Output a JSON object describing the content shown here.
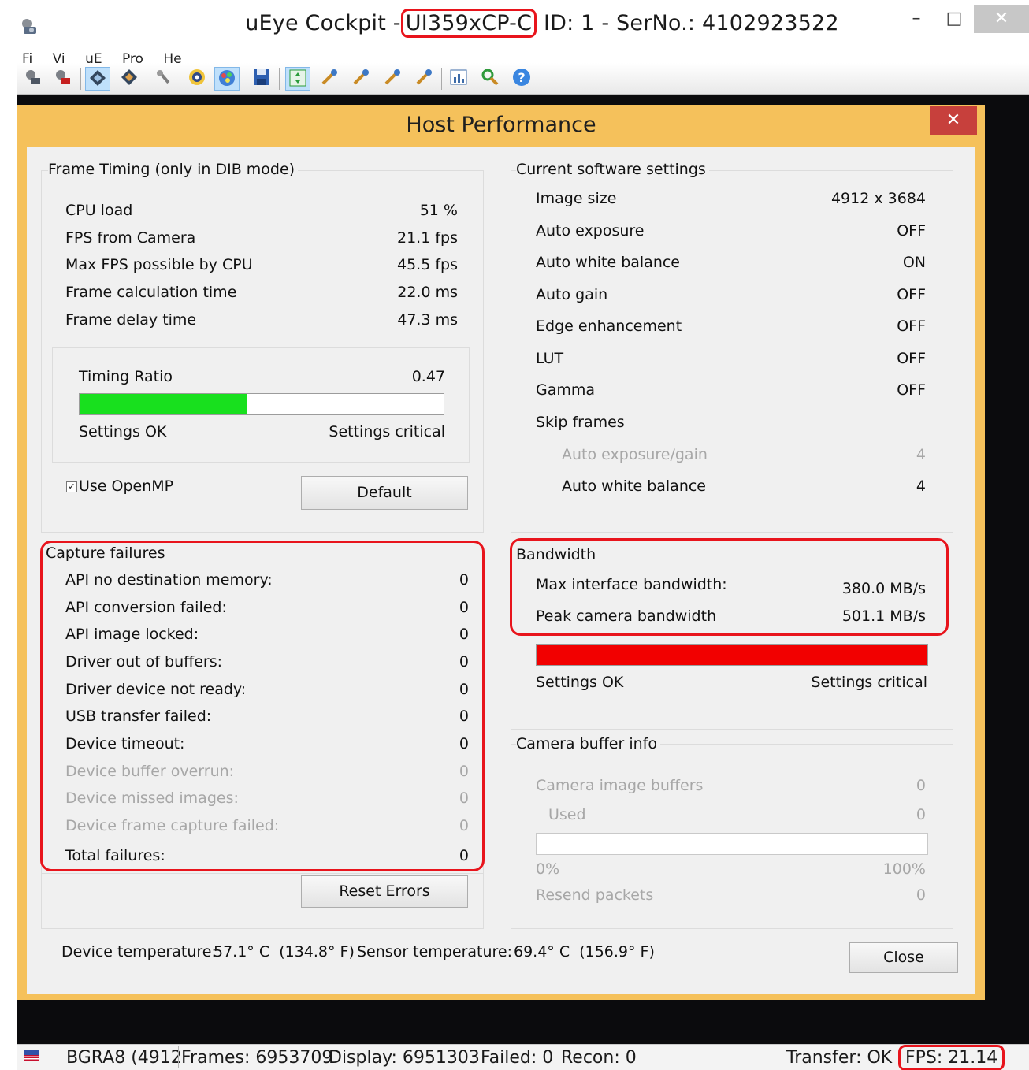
{
  "window": {
    "title_prefix": "uEye Cockpit -",
    "title_model": "UI359xCP-C",
    "title_suffix": "ID: 1 - SerNo.: 4102923522",
    "min_glyph": "–",
    "max_glyph": "□",
    "close_glyph": "✕"
  },
  "menu": [
    "Fi",
    "Vi",
    "uE",
    "Pro",
    "He"
  ],
  "dialog": {
    "title": "Host Performance",
    "close_glyph": "✕",
    "frame_timing": {
      "title": "Frame Timing (only in DIB mode)",
      "rows": [
        {
          "label": "CPU load",
          "value": "51 %"
        },
        {
          "label": "FPS from Camera",
          "value": "21.1 fps"
        },
        {
          "label": "Max FPS possible by CPU",
          "value": "45.5 fps"
        },
        {
          "label": "Frame calculation time",
          "value": "22.0 ms"
        },
        {
          "label": "Frame delay time",
          "value": "47.3 ms"
        }
      ],
      "timing_ratio_label": "Timing Ratio",
      "timing_ratio_value": "0.47",
      "timing_ratio_fraction": 0.46,
      "bar_color": "#18e01e",
      "settings_ok": "Settings OK",
      "settings_critical": "Settings critical",
      "use_openmp": "Use OpenMP",
      "default_button": "Default"
    },
    "software_settings": {
      "title": "Current software settings",
      "rows": [
        {
          "label": "Image size",
          "value": "4912 x 3684"
        },
        {
          "label": "Auto exposure",
          "value": "OFF"
        },
        {
          "label": "Auto white balance",
          "value": "ON"
        },
        {
          "label": "Auto gain",
          "value": "OFF"
        },
        {
          "label": "Edge enhancement",
          "value": "OFF"
        },
        {
          "label": "LUT",
          "value": "OFF"
        },
        {
          "label": "Gamma",
          "value": "OFF"
        }
      ],
      "skip_frames_label": "Skip frames",
      "skip_rows": [
        {
          "label": "Auto exposure/gain",
          "value": "4",
          "disabled": true
        },
        {
          "label": "Auto white balance",
          "value": "4",
          "disabled": false
        }
      ]
    },
    "capture_failures": {
      "title": "Capture failures",
      "rows": [
        {
          "label": "API no destination memory:",
          "value": "0",
          "disabled": false
        },
        {
          "label": "API conversion failed:",
          "value": "0",
          "disabled": false
        },
        {
          "label": "API image locked:",
          "value": "0",
          "disabled": false
        },
        {
          "label": "Driver out of buffers:",
          "value": "0",
          "disabled": false
        },
        {
          "label": "Driver device not ready:",
          "value": "0",
          "disabled": false
        },
        {
          "label": "USB transfer failed:",
          "value": "0",
          "disabled": false
        },
        {
          "label": "Device timeout:",
          "value": "0",
          "disabled": false
        },
        {
          "label": "Device buffer overrun:",
          "value": "0",
          "disabled": true
        },
        {
          "label": "Device missed images:",
          "value": "0",
          "disabled": true
        },
        {
          "label": "Device frame capture failed:",
          "value": "0",
          "disabled": true
        },
        {
          "label": "Total failures:",
          "value": "0",
          "disabled": false
        }
      ],
      "reset_button": "Reset Errors"
    },
    "bandwidth": {
      "title": "Bandwidth",
      "max_label": "Max interface bandwidth:",
      "max_value": "380.0 MB/s",
      "peak_label": "Peak camera bandwidth",
      "peak_value": "501.1 MB/s",
      "bar_fraction": 1.0,
      "bar_color": "#f20000",
      "settings_ok": "Settings OK",
      "settings_critical": "Settings critical"
    },
    "camera_buffer": {
      "title": "Camera buffer info",
      "image_buffers_label": "Camera image buffers",
      "image_buffers_value": "0",
      "used_label": "Used",
      "used_value": "0",
      "min_label": "0%",
      "max_label": "100%",
      "resend_label": "Resend packets",
      "resend_value": "0"
    },
    "footer": {
      "device_temp_label": "Device temperature:",
      "device_temp_value": "57.1° C  (134.8° F)",
      "sensor_temp_label": "Sensor temperature:",
      "sensor_temp_value": "69.4° C  (156.9° F)",
      "close_button": "Close"
    }
  },
  "status": {
    "format": "BGRA8 (4912",
    "frames": "Frames: 6953709",
    "display": "Display: 6951303",
    "failed": "Failed: 0",
    "recon": "Recon: 0",
    "transfer": "Transfer: OK",
    "fps": "FPS: 21.14"
  }
}
